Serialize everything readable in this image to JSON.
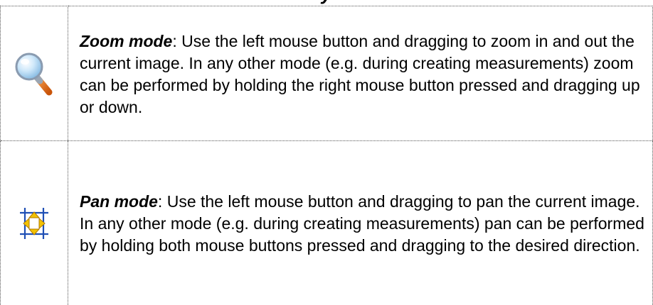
{
  "heading_fragment": "y",
  "rows": [
    {
      "icon": "magnifier-icon",
      "mode_name": "Zoom mode",
      "separator": ":",
      "description": " Use the left mouse button and dragging to zoom in and out the current image. In any other mode (e.g. during creating measurements) zoom can be performed by holding the right mouse button pressed and dragging up or down."
    },
    {
      "icon": "pan-arrows-icon",
      "mode_name": "Pan mode",
      "separator": ":",
      "description": " Use the left mouse button and dragging to pan the current image. In any other mode (e.g. during creating measurements) pan can be performed by holding both mouse buttons pressed and dragging to the desired direction."
    }
  ],
  "colors": {
    "magnifier_lens": "#a9d4f2",
    "magnifier_rim": "#8a9bb0",
    "magnifier_handle": "#e8731a",
    "pan_frame": "#1f4fb5",
    "pan_arrows": "#f2c200",
    "pan_arrow_outline": "#b07a00"
  }
}
